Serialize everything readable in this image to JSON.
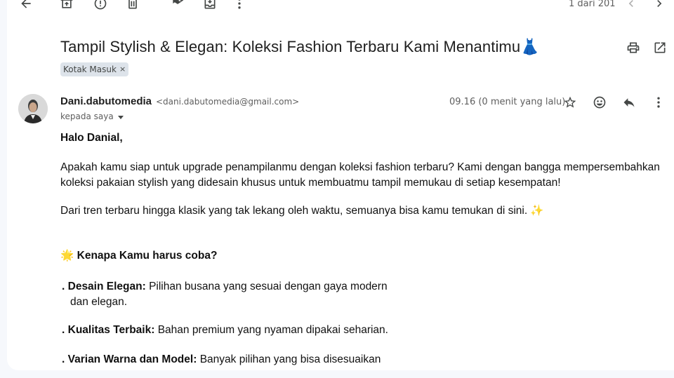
{
  "toolbar": {
    "icons": [
      "back-arrow-icon",
      "archive-icon",
      "report-spam-icon",
      "delete-icon",
      "mark-unread-icon",
      "move-to-icon",
      "more-vert-icon"
    ],
    "pager": "1 dari 201"
  },
  "email": {
    "subject": "Tampil Stylish & Elegan: Koleksi Fashion Terbaru Kami Menantimu👗",
    "label": "Kotak Masuk",
    "label_remove": "×",
    "sender_name": "Dani.dabutomedia",
    "sender_email": "<dani.dabutomedia@gmail.com>",
    "recipient": "kepada saya",
    "timestamp": "09.16 (0 menit yang lalu)"
  },
  "body": {
    "greeting": "Halo Danial,",
    "para1": "Apakah kamu siap untuk upgrade penampilanmu dengan koleksi fashion terbaru? Kami dengan bangga mempersembahkan koleksi pakaian stylish yang didesain khusus untuk membuatmu tampil memukau di setiap kesempatan!",
    "para2": "Dari tren terbaru hingga klasik yang tak lekang oleh waktu, semuanya bisa kamu temukan di sini. ✨",
    "why_emoji": "🌟",
    "why_heading": "Kenapa Kamu harus coba?",
    "bullets": [
      {
        "marker": ".",
        "title": "Desain Elegan:",
        "text": "Pilihan busana yang sesuai dengan gaya modern",
        "text2": "dan elegan."
      },
      {
        "marker": ".",
        "title": "Kualitas Terbaik:",
        "text": "Bahan premium yang nyaman dipakai seharian."
      },
      {
        "marker": ".",
        "title": "Varian Warna dan Model:",
        "text": "Banyak pilihan yang bisa disesuaikan"
      }
    ]
  }
}
